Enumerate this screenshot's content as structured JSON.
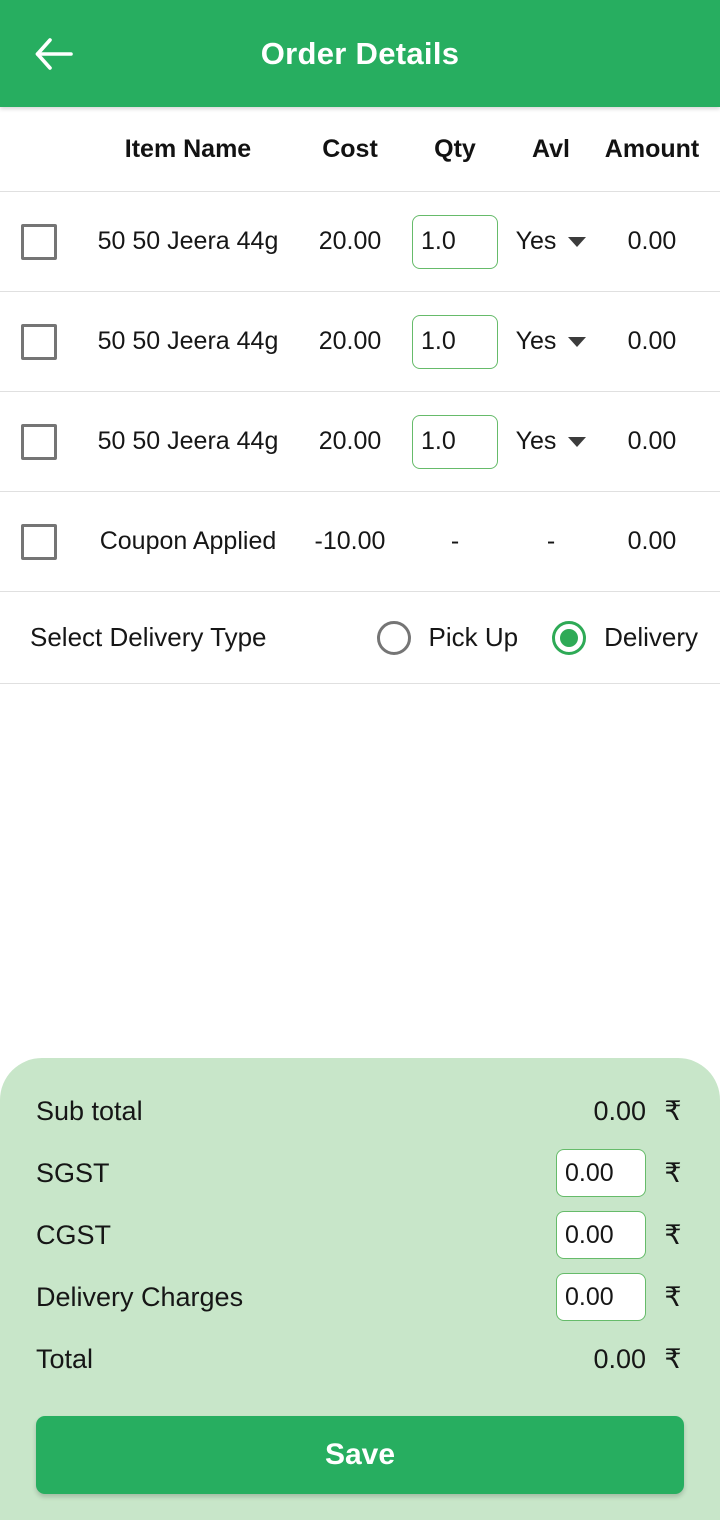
{
  "theme": {
    "primary_green": "#27ae60",
    "panel_green": "#c8e6c9",
    "border_green": "#66bb6a",
    "divider": "#e0e0e0",
    "checkbox_gray": "#757575"
  },
  "appbar": {
    "title": "Order Details",
    "back_icon": "arrow-left-icon"
  },
  "table": {
    "headers": {
      "item_name": "Item Name",
      "cost": "Cost",
      "qty": "Qty",
      "avl": "Avl",
      "amount": "Amount"
    },
    "rows": [
      {
        "name": "50 50 Jeera 44g",
        "cost": "20.00",
        "qty": "1.0",
        "avl": "Yes",
        "amount": "0.00",
        "checked": false,
        "has_qty_input": true,
        "has_avl_dropdown": true
      },
      {
        "name": "50 50 Jeera 44g",
        "cost": "20.00",
        "qty": "1.0",
        "avl": "Yes",
        "amount": "0.00",
        "checked": false,
        "has_qty_input": true,
        "has_avl_dropdown": true
      },
      {
        "name": "50 50 Jeera 44g",
        "cost": "20.00",
        "qty": "1.0",
        "avl": "Yes",
        "amount": "0.00",
        "checked": false,
        "has_qty_input": true,
        "has_avl_dropdown": true
      },
      {
        "name": "Coupon Applied",
        "cost": "-10.00",
        "qty": "-",
        "avl": "-",
        "amount": "0.00",
        "checked": false,
        "has_qty_input": false,
        "has_avl_dropdown": false
      }
    ]
  },
  "delivery": {
    "label": "Select Delivery Type",
    "options": [
      {
        "label": "Pick Up",
        "selected": false
      },
      {
        "label": "Delivery",
        "selected": true
      }
    ]
  },
  "totals": {
    "currency_symbol": "₹",
    "lines": [
      {
        "label": "Sub total",
        "value": "0.00",
        "editable": false
      },
      {
        "label": "SGST",
        "value": "0.00",
        "editable": true
      },
      {
        "label": "CGST",
        "value": "0.00",
        "editable": true
      },
      {
        "label": "Delivery Charges",
        "value": "0.00",
        "editable": true
      },
      {
        "label": "Total",
        "value": "0.00",
        "editable": false
      }
    ],
    "save_label": "Save"
  }
}
